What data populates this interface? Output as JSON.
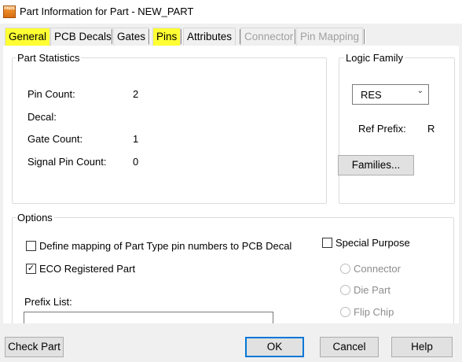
{
  "window": {
    "title": "Part Information for Part - NEW_PART",
    "icon_text": "PADS"
  },
  "tabs": [
    {
      "label": "General",
      "state": "active"
    },
    {
      "label": "PCB Decals",
      "state": "normal"
    },
    {
      "label": "Gates",
      "state": "normal"
    },
    {
      "label": "Pins",
      "state": "highlighted"
    },
    {
      "label": "Attributes",
      "state": "normal"
    },
    {
      "label": "Connector",
      "state": "disabled"
    },
    {
      "label": "Pin Mapping",
      "state": "disabled"
    }
  ],
  "part_statistics": {
    "title": "Part Statistics",
    "rows": [
      {
        "label": "Pin Count:",
        "value": "2"
      },
      {
        "label": "Decal:",
        "value": ""
      },
      {
        "label": "Gate Count:",
        "value": "1"
      },
      {
        "label": "Signal Pin Count:",
        "value": "0"
      }
    ]
  },
  "logic_family": {
    "title": "Logic Family",
    "selected": "RES",
    "ref_prefix_label": "Ref Prefix:",
    "ref_prefix_value": "R",
    "families_button": "Families..."
  },
  "options": {
    "title": "Options",
    "define_mapping": {
      "label": "Define mapping of Part Type pin numbers to PCB Decal",
      "checked": false
    },
    "eco_registered": {
      "label": "ECO Registered Part",
      "checked": true
    },
    "special_purpose": {
      "label": "Special Purpose",
      "checked": false
    },
    "radios": [
      {
        "label": "Connector",
        "enabled": false
      },
      {
        "label": "Die Part",
        "enabled": false
      },
      {
        "label": "Flip Chip",
        "enabled": false
      }
    ],
    "prefix_list_label": "Prefix List:",
    "prefix_list_value": ""
  },
  "buttons": {
    "check_part": "Check Part",
    "ok": "OK",
    "cancel": "Cancel",
    "help": "Help"
  },
  "colors": {
    "highlight": "#ffff33",
    "focus_border": "#0078d7"
  }
}
